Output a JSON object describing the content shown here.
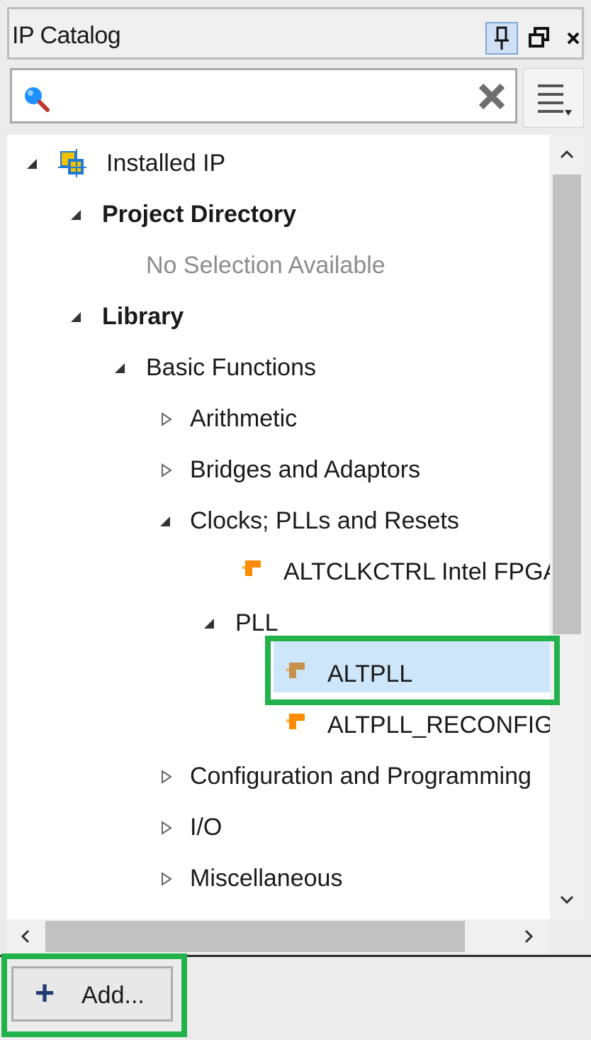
{
  "panel": {
    "title": "IP Catalog",
    "controls": [
      {
        "name": "pin",
        "icon": "pin-icon"
      },
      {
        "name": "float",
        "icon": "restore-window-icon"
      },
      {
        "name": "close",
        "icon": "close-icon"
      }
    ]
  },
  "search": {
    "value": "",
    "placeholder": "",
    "icon": "search-icon",
    "clear_icon": "clear-icon",
    "menu_icon": "hamburger-menu-icon"
  },
  "tree": {
    "installed_ip": "Installed IP",
    "project_directory": "Project Directory",
    "no_selection": "No Selection Available",
    "library": "Library",
    "basic_functions": "Basic Functions",
    "arithmetic": "Arithmetic",
    "bridges": "Bridges and Adaptors",
    "clocks": "Clocks; PLLs and Resets",
    "altclkctrl": "ALTCLKCTRL Intel FPGA IP",
    "pll": "PLL",
    "altpll": "ALTPLL",
    "altpll_reconfig": "ALTPLL_RECONFIG",
    "configuration": "Configuration and Programming",
    "io": "I/O",
    "misc": "Miscellaneous",
    "selected_item": "ALTPLL"
  },
  "footer": {
    "add_label": "Add..."
  },
  "colors": {
    "selection": "#cde6fa",
    "highlight_box": "#22b24c",
    "ip_orange": "#ff8c00",
    "ip_tan": "#c8914a"
  }
}
